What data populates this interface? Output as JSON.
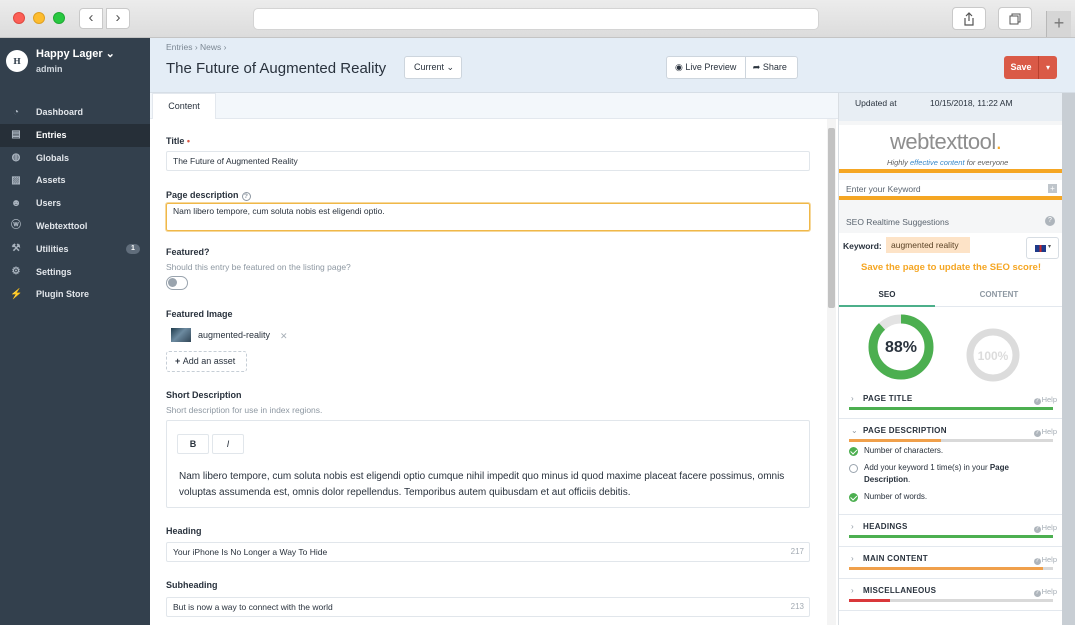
{
  "sidebar": {
    "site_logo": "H",
    "site_name": "Happy Lager ⌄",
    "user": "admin",
    "items": [
      {
        "label": "Dashboard",
        "icon": "gauge-icon"
      },
      {
        "label": "Entries",
        "icon": "entries-icon"
      },
      {
        "label": "Globals",
        "icon": "globe-icon"
      },
      {
        "label": "Assets",
        "icon": "image-icon"
      },
      {
        "label": "Users",
        "icon": "users-icon"
      },
      {
        "label": "Webtexttool",
        "icon": "webtexttool-icon"
      },
      {
        "label": "Utilities",
        "icon": "wrench-icon",
        "badge": "1"
      },
      {
        "label": "Settings",
        "icon": "gear-icon"
      },
      {
        "label": "Plugin Store",
        "icon": "plug-icon"
      }
    ]
  },
  "header": {
    "breadcrumb": "Entries › News ›",
    "title": "The Future of Augmented Reality",
    "revision": "Current ⌄",
    "live_preview": "Live Preview",
    "share": "Share",
    "save": "Save"
  },
  "tabs": {
    "content": "Content"
  },
  "fields": {
    "title_label": "Title",
    "title_value": "The Future of Augmented Reality",
    "page_desc_label": "Page description",
    "page_desc_value": "Nam libero tempore, cum soluta nobis est eligendi optio.",
    "featured_label": "Featured?",
    "featured_hint": "Should this entry be featured on the listing page?",
    "featured_on": false,
    "image_label": "Featured Image",
    "image_name": "augmented-reality",
    "add_asset": "Add an asset",
    "short_label": "Short Description",
    "short_hint": "Short description for use in index regions.",
    "bold": "B",
    "italic": "I",
    "short_text": "Nam libero tempore, cum soluta nobis est eligendi optio cumque nihil impedit quo minus id quod maxime placeat facere possimus, omnis voluptas assumenda est, omnis dolor repellendus. Temporibus autem quibusdam et aut officiis debitis.",
    "heading_label": "Heading",
    "heading_value": "Your iPhone Is No Longer a Way To Hide",
    "heading_count": "217",
    "subheading_label": "Subheading",
    "subheading_value": "But is now a way to connect with the world",
    "subheading_count": "213"
  },
  "seo": {
    "updated_label": "Updated at",
    "updated_value": "10/15/2018, 11:22 AM",
    "logo_web": "webtexttool",
    "logo_dot": ".",
    "tagline_pre": "Highly ",
    "tagline_em": "effective content",
    "tagline_post": " for everyone",
    "keyword_placeholder": "Enter your Keyword",
    "suggestions_title": "SEO Realtime Suggestions",
    "keyword_label": "Keyword:",
    "keyword_value": "augmented reality",
    "save_warning": "Save the page to update the SEO score!",
    "tab_seo": "SEO",
    "tab_content": "CONTENT",
    "seo_score": 88,
    "seo_score_label": "88%",
    "content_score_label": "100%",
    "help": "Help",
    "rows": [
      {
        "name": "PAGE TITLE",
        "fill": 1.0,
        "color": "#4caf50"
      },
      {
        "name": "PAGE DESCRIPTION",
        "fill": 0.45,
        "color": "#f0a04b"
      },
      {
        "name": "HEADINGS",
        "fill": 1.0,
        "color": "#4caf50"
      },
      {
        "name": "MAIN CONTENT",
        "fill": 0.95,
        "color": "#f0a04b"
      },
      {
        "name": "MISCELLANEOUS",
        "fill": 0.2,
        "color": "#d9373a"
      }
    ],
    "desc_checks": [
      {
        "text": "Number of characters.",
        "ok": true
      },
      {
        "text_pre": "Add your keyword 1 time(s) in your ",
        "text_bold": "Page Description",
        "text_post": ".",
        "ok": false
      },
      {
        "text": "Number of words.",
        "ok": true
      }
    ]
  }
}
